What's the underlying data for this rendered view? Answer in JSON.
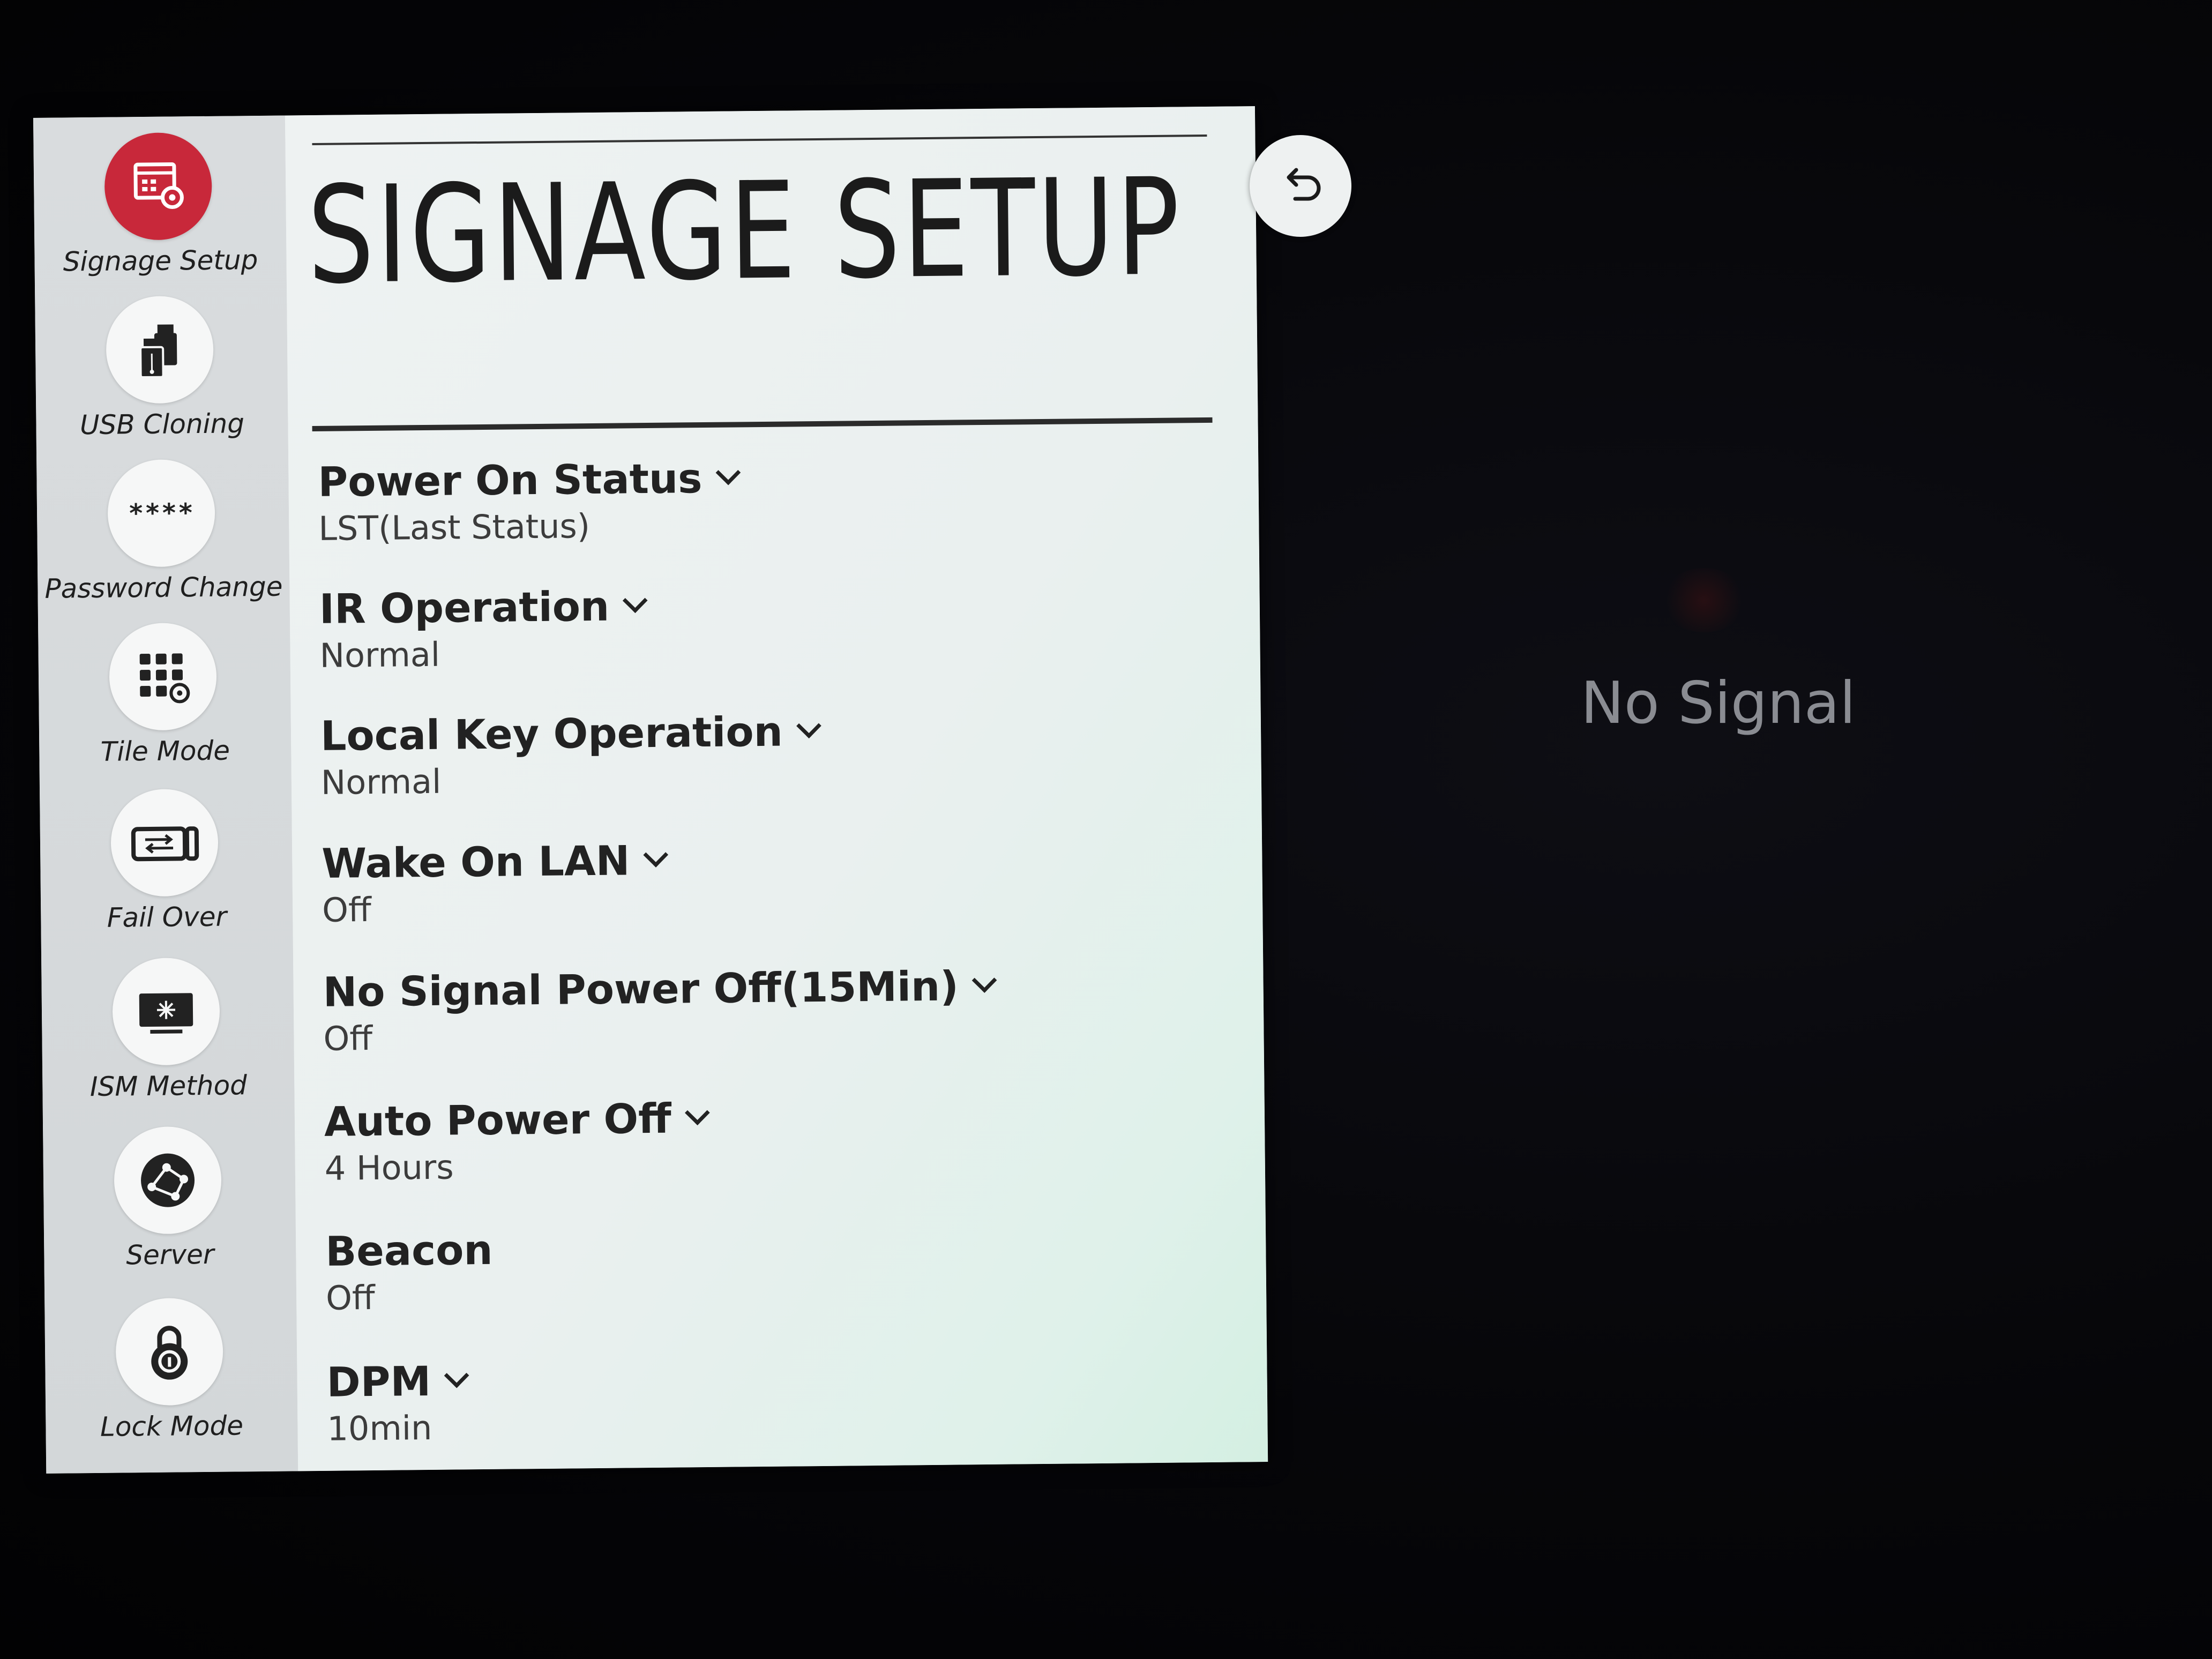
{
  "page_title": "SIGNAGE SETUP",
  "no_signal_text": "No Signal",
  "colors": {
    "active_accent": "#c8283a",
    "panel_background": "#eef2f2",
    "sidebar_background": "#d6dadc",
    "screen_background": "#050508"
  },
  "sidebar": {
    "items": [
      {
        "label": "Signage Setup",
        "icon": "signage-setup-icon",
        "active": true
      },
      {
        "label": "USB Cloning",
        "icon": "usb-cloning-icon",
        "active": false
      },
      {
        "label": "Password Change",
        "icon": "password-icon",
        "active": false
      },
      {
        "label": "Tile Mode",
        "icon": "tile-mode-icon",
        "active": false
      },
      {
        "label": "Fail Over",
        "icon": "fail-over-icon",
        "active": false
      },
      {
        "label": "ISM Method",
        "icon": "ism-method-icon",
        "active": false
      },
      {
        "label": "Server",
        "icon": "server-icon",
        "active": false
      },
      {
        "label": "Lock Mode",
        "icon": "lock-icon",
        "active": false
      }
    ],
    "password_icon_text": "****"
  },
  "settings": [
    {
      "label": "Power On Status",
      "value": "LST(Last Status)",
      "has_dropdown": true
    },
    {
      "label": "IR Operation",
      "value": "Normal",
      "has_dropdown": true
    },
    {
      "label": "Local Key Operation",
      "value": "Normal",
      "has_dropdown": true
    },
    {
      "label": "Wake On LAN",
      "value": "Off",
      "has_dropdown": true
    },
    {
      "label": "No Signal Power Off(15Min)",
      "value": "Off",
      "has_dropdown": true
    },
    {
      "label": "Auto Power Off",
      "value": "4 Hours",
      "has_dropdown": true
    },
    {
      "label": "Beacon",
      "value": "Off",
      "has_dropdown": false
    },
    {
      "label": "DPM",
      "value": "10min",
      "has_dropdown": true
    }
  ],
  "back_button_icon": "back-arrow-icon"
}
